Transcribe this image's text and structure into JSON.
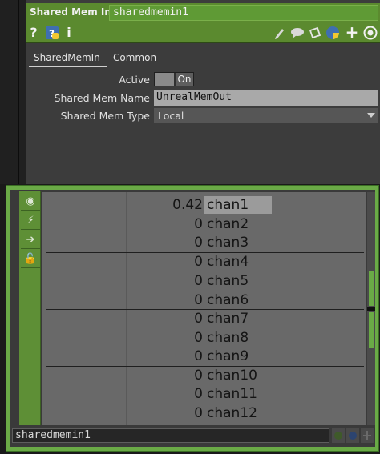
{
  "header": {
    "op_type": "Shared Mem In",
    "op_name": "sharedmemin1"
  },
  "toolbar": {
    "help_label": "?",
    "info_label": "i",
    "icons": [
      "help-icon",
      "python-help-icon",
      "info-icon",
      "pencil-icon",
      "comment-icon",
      "paste-icon",
      "python-icon",
      "plus-icon",
      "target-icon"
    ]
  },
  "tabs": [
    {
      "label": "SharedMemIn",
      "active": true
    },
    {
      "label": "Common",
      "active": false
    }
  ],
  "params": {
    "active": {
      "label": "Active",
      "value": "On"
    },
    "shared_mem_name": {
      "label": "Shared Mem Name",
      "value": "UnrealMemOut"
    },
    "shared_mem_type": {
      "label": "Shared Mem Type",
      "value": "Local"
    }
  },
  "viewer": {
    "rows": [
      {
        "value": "0.42",
        "name": "chan1"
      },
      {
        "value": "0",
        "name": "chan2"
      },
      {
        "value": "0",
        "name": "chan3"
      },
      {
        "value": "0",
        "name": "chan4"
      },
      {
        "value": "0",
        "name": "chan5"
      },
      {
        "value": "0",
        "name": "chan6"
      },
      {
        "value": "0",
        "name": "chan7"
      },
      {
        "value": "0",
        "name": "chan8"
      },
      {
        "value": "0",
        "name": "chan9"
      },
      {
        "value": "0",
        "name": "chan10"
      },
      {
        "value": "0",
        "name": "chan11"
      },
      {
        "value": "0",
        "name": "chan12"
      }
    ]
  },
  "node": {
    "footer_name": "sharedmemin1"
  },
  "colors": {
    "accent_green": "#5b8a2f",
    "node_green": "#6aaa46",
    "panel_bg": "#3c3c3c"
  }
}
